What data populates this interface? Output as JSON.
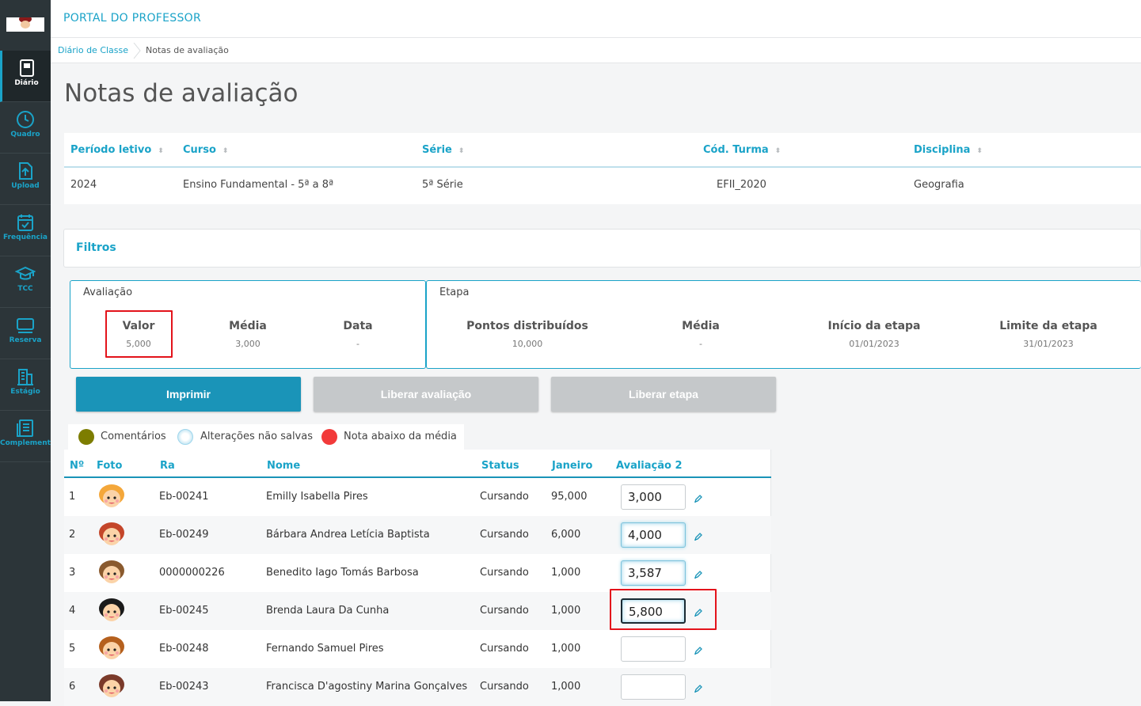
{
  "sidebar": {
    "items": [
      {
        "label": "Diário",
        "icon": "book-icon",
        "active": true
      },
      {
        "label": "Quadro",
        "icon": "clock-icon"
      },
      {
        "label": "Upload",
        "icon": "upload-icon"
      },
      {
        "label": "Frequência",
        "icon": "calendar-check-icon"
      },
      {
        "label": "TCC",
        "icon": "graduation-cap-icon"
      },
      {
        "label": "Reserva",
        "icon": "monitor-icon"
      },
      {
        "label": "Estágio",
        "icon": "building-icon"
      },
      {
        "label": "Complement",
        "icon": "document-list-icon"
      }
    ]
  },
  "header": {
    "portal_title": "PORTAL DO PROFESSOR"
  },
  "breadcrumb": {
    "parent": "Diário de Classe",
    "current": "Notas de avaliação"
  },
  "page_title": "Notas de avaliação",
  "info_table": {
    "headers": [
      "Período letivo",
      "Curso",
      "Série",
      "Cód. Turma",
      "Disciplina"
    ],
    "values": [
      "2024",
      "Ensino Fundamental - 5ª a 8ª",
      "5ª Série",
      "EFII_2020",
      "Geografia"
    ]
  },
  "filtros": {
    "label": "Filtros"
  },
  "avaliacao": {
    "title": "Avaliação",
    "stats": [
      {
        "label": "Valor",
        "value": "5,000"
      },
      {
        "label": "Média",
        "value": "3,000"
      },
      {
        "label": "Data",
        "value": "-"
      }
    ]
  },
  "etapa": {
    "title": "Etapa",
    "stats": [
      {
        "label": "Pontos distribuídos",
        "value": "10,000"
      },
      {
        "label": "Média",
        "value": "-"
      },
      {
        "label": "Início da etapa",
        "value": "01/01/2023"
      },
      {
        "label": "Limite da etapa",
        "value": "31/01/2023"
      }
    ]
  },
  "buttons": {
    "print": "Imprimir",
    "release_evaluation": "Liberar avaliação",
    "release_stage": "Liberar etapa"
  },
  "legend": {
    "items": [
      {
        "label": "Comentários",
        "color": "#7d7d00"
      },
      {
        "label": "Alterações não salvas",
        "color": "#bfe6f5"
      },
      {
        "label": "Nota abaixo da média",
        "color": "#f23a3a"
      }
    ]
  },
  "grid": {
    "headers": [
      "Nº",
      "Foto",
      "Ra",
      "Nome",
      "Status",
      "Janeiro",
      "Avaliação 2"
    ],
    "rows": [
      {
        "n": "1",
        "ra": "Eb-00241",
        "nome": "Emilly Isabella Pires",
        "status": "Cursando",
        "janeiro": "95,000",
        "nota": "3,000",
        "hair": "#f4a73a"
      },
      {
        "n": "2",
        "ra": "Eb-00249",
        "nome": "Bárbara Andrea Letícia Baptista",
        "status": "Cursando",
        "janeiro": "6,000",
        "nota": "4,000",
        "hair": "#c4462a"
      },
      {
        "n": "3",
        "ra": "0000000226",
        "nome": "Benedito Iago Tomás Barbosa",
        "status": "Cursando",
        "janeiro": "1,000",
        "nota": "3,587",
        "hair": "#8a5a2e"
      },
      {
        "n": "4",
        "ra": "Eb-00245",
        "nome": "Brenda Laura Da Cunha",
        "status": "Cursando",
        "janeiro": "1,000",
        "nota": "5,800",
        "hair": "#1a1a1a"
      },
      {
        "n": "5",
        "ra": "Eb-00248",
        "nome": "Fernando Samuel Pires",
        "status": "Cursando",
        "janeiro": "1,000",
        "nota": "",
        "hair": "#b5601e"
      },
      {
        "n": "6",
        "ra": "Eb-00243",
        "nome": "Francisca D'agostiny Marina Gonçalves",
        "status": "Cursando",
        "janeiro": "1,000",
        "nota": "",
        "hair": "#7a3a2a"
      }
    ]
  },
  "colors": {
    "accent": "#1aa3c8",
    "sidebar": "#2c3539",
    "highlight": "#e3131b"
  }
}
